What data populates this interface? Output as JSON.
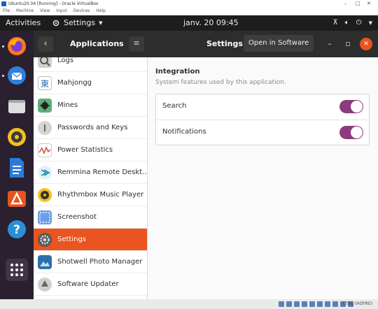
{
  "vbox": {
    "title": "Ubuntu20.04 [Running] - Oracle VirtualBox",
    "menu": [
      "File",
      "Machine",
      "View",
      "Input",
      "Devices",
      "Help"
    ],
    "status_host_key": "CTRL (HOYRE)"
  },
  "topbar": {
    "activities": "Activities",
    "app_menu": "Settings",
    "clock": "janv. 20  09:45"
  },
  "dock": {
    "items": [
      "firefox-icon",
      "thunderbird-icon",
      "files-icon",
      "rhythmbox-icon",
      "writer-icon",
      "software-icon",
      "help-icon",
      "show-apps-icon"
    ]
  },
  "header": {
    "left_title": "Applications",
    "right_title": "Settings",
    "open_in_software": "Open in Software"
  },
  "apps": [
    {
      "label": "Logs",
      "icon": "logs-icon",
      "color": "#9a9a9a"
    },
    {
      "label": "Mahjongg",
      "icon": "mahjongg-icon",
      "color": "#4a80c0"
    },
    {
      "label": "Mines",
      "icon": "mines-icon",
      "color": "#3c8f5a"
    },
    {
      "label": "Passwords and Keys",
      "icon": "passwords-icon",
      "color": "#b5b5b5"
    },
    {
      "label": "Power Statistics",
      "icon": "power-stats-icon",
      "color": "#d05050"
    },
    {
      "label": "Remmina Remote Deskt…",
      "icon": "remmina-icon",
      "color": "#2f8fb0"
    },
    {
      "label": "Rhythmbox Music Player",
      "icon": "rhythmbox-icon",
      "color": "#f4c01e"
    },
    {
      "label": "Screenshot",
      "icon": "screenshot-icon",
      "color": "#5a8fd8"
    },
    {
      "label": "Settings",
      "icon": "settings-icon",
      "color": "#777777",
      "selected": true
    },
    {
      "label": "Shotwell Photo Manager",
      "icon": "shotwell-icon",
      "color": "#2d6fa8"
    },
    {
      "label": "Software Updater",
      "icon": "updater-icon",
      "color": "#8a8a8a"
    }
  ],
  "integration": {
    "title": "Integration",
    "subtitle": "System features used by this application.",
    "rows": [
      {
        "label": "Search",
        "on": true
      },
      {
        "label": "Notifications",
        "on": true
      }
    ]
  },
  "colors": {
    "accent": "#e95420",
    "toggle_on": "#8d3b7d"
  }
}
